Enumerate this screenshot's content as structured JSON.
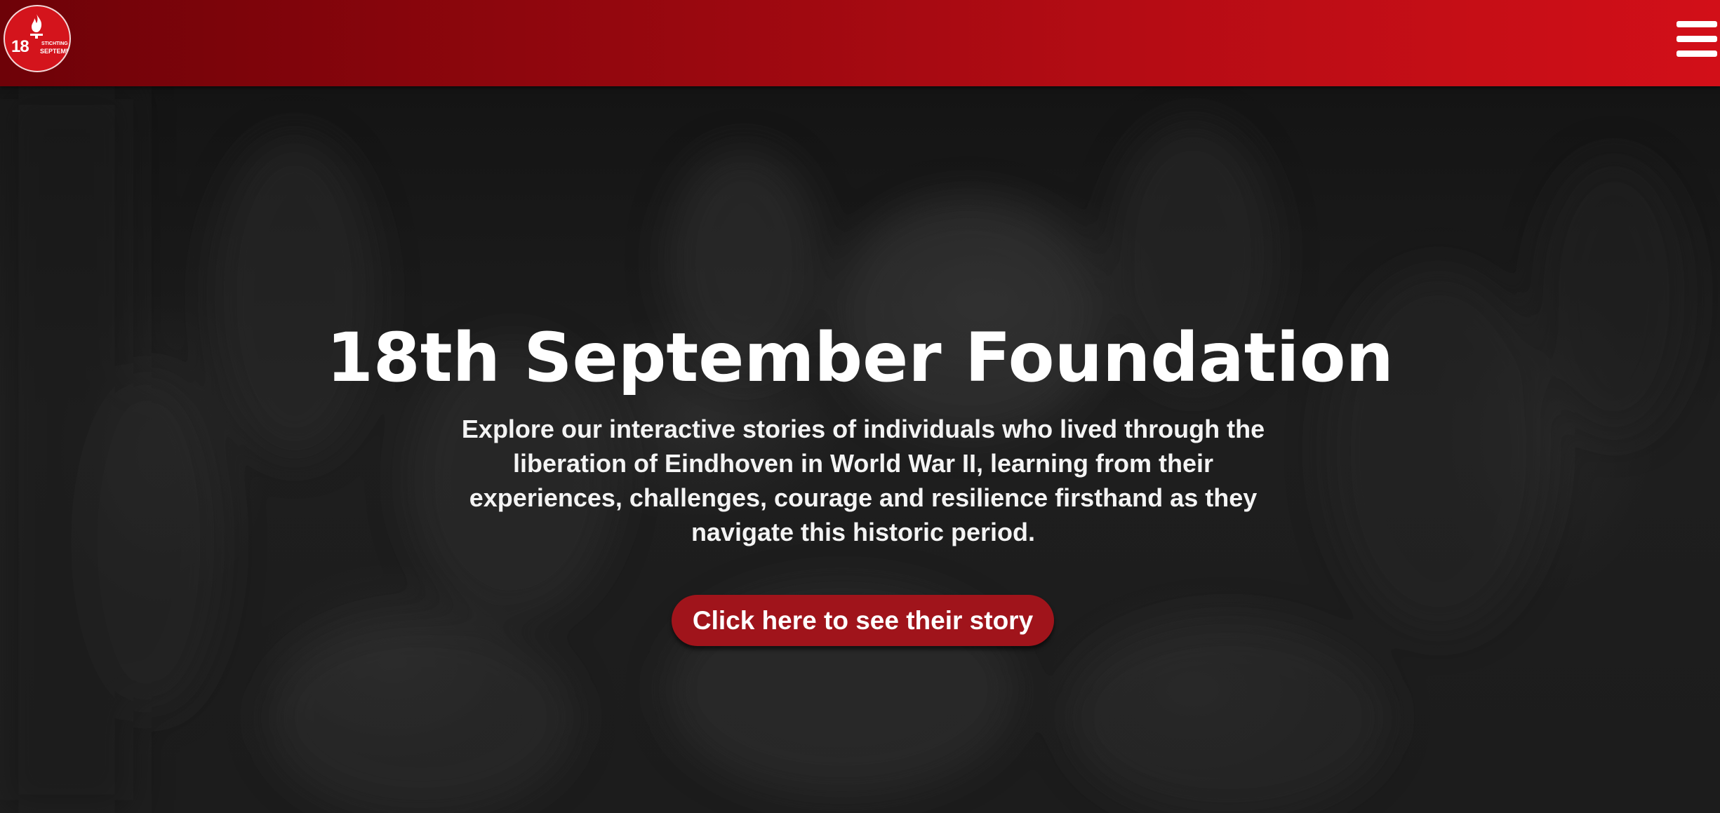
{
  "header": {
    "logo": {
      "icon": "flame-icon",
      "number": "18",
      "line1": "STICHTING",
      "line2": "SEPTEMBER"
    },
    "menu_icon": "hamburger-menu-icon",
    "gradient_colors": [
      "#6e0208",
      "#d20f18"
    ]
  },
  "hero": {
    "title": "18th September Foundation",
    "text": "Explore our interactive stories of individuals who lived through the liberation of Eindhoven in World War II, learning from their experiences, challenges, courage and resilience firsthand as they navigate this historic period.",
    "cta_label": "Click here to see their story",
    "cta_color": "#a0141b",
    "background": "dark blurred black-and-white historical photograph"
  }
}
